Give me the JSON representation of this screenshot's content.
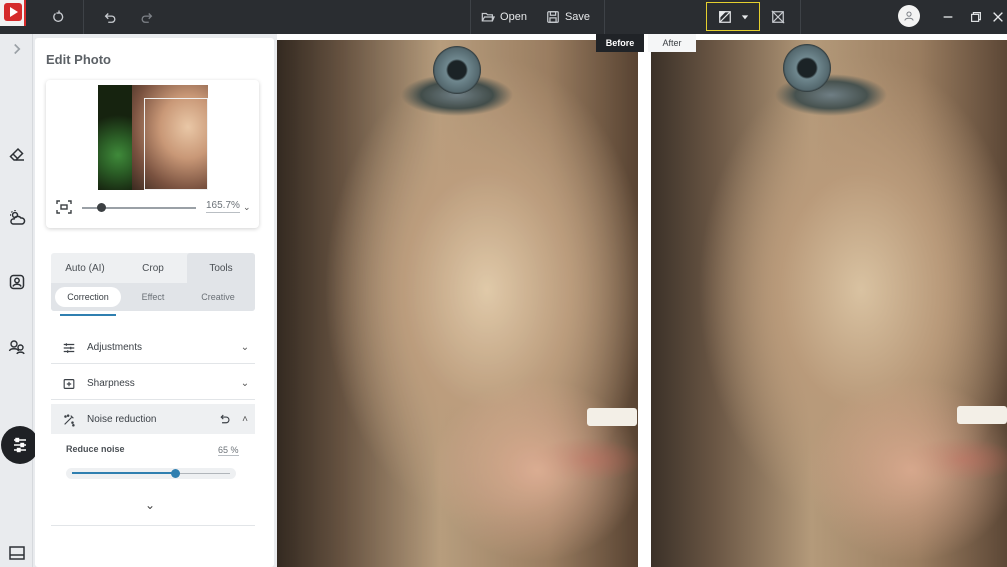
{
  "titlebar": {
    "open_label": "Open",
    "save_label": "Save",
    "icons": [
      "app-logo",
      "rotate-icon",
      "undo-icon",
      "redo-icon",
      "folder-open-icon",
      "save-icon",
      "compare-split-icon",
      "dropdown-arrow-icon",
      "compare-off-icon",
      "user-icon",
      "minimize-icon",
      "restore-icon",
      "close-icon"
    ]
  },
  "rail": {
    "icons": [
      "expand-chevron-icon",
      "eraser-icon",
      "sky-icon",
      "portrait-icon",
      "face-swap-icon",
      "adjust-sliders-icon",
      "layout-icon"
    ]
  },
  "panel": {
    "title": "Edit Photo",
    "zoom_value": "165.7%",
    "tabs": [
      {
        "label": "Auto (AI)",
        "active": false
      },
      {
        "label": "Crop",
        "active": false
      },
      {
        "label": "Tools",
        "active": true
      }
    ],
    "subtabs": [
      {
        "label": "Correction",
        "active": true
      },
      {
        "label": "Effect",
        "active": false
      },
      {
        "label": "Creative",
        "active": false
      }
    ],
    "sections": [
      {
        "label": "Adjustments",
        "icon": "sliders-icon",
        "expanded": false
      },
      {
        "label": "Sharpness",
        "icon": "sharpness-icon",
        "expanded": false
      },
      {
        "label": "Noise reduction",
        "icon": "noise-icon",
        "expanded": true
      }
    ],
    "noise": {
      "label": "Reduce noise",
      "value_text": "65 %",
      "value": 65
    }
  },
  "compare": {
    "before_label": "Before",
    "after_label": "After"
  },
  "colors": {
    "titlebar": "#2a2d31",
    "accent": "#2f7fb0",
    "highlight_border": "#e4cf2e",
    "logo_red": "#d52b2b"
  }
}
